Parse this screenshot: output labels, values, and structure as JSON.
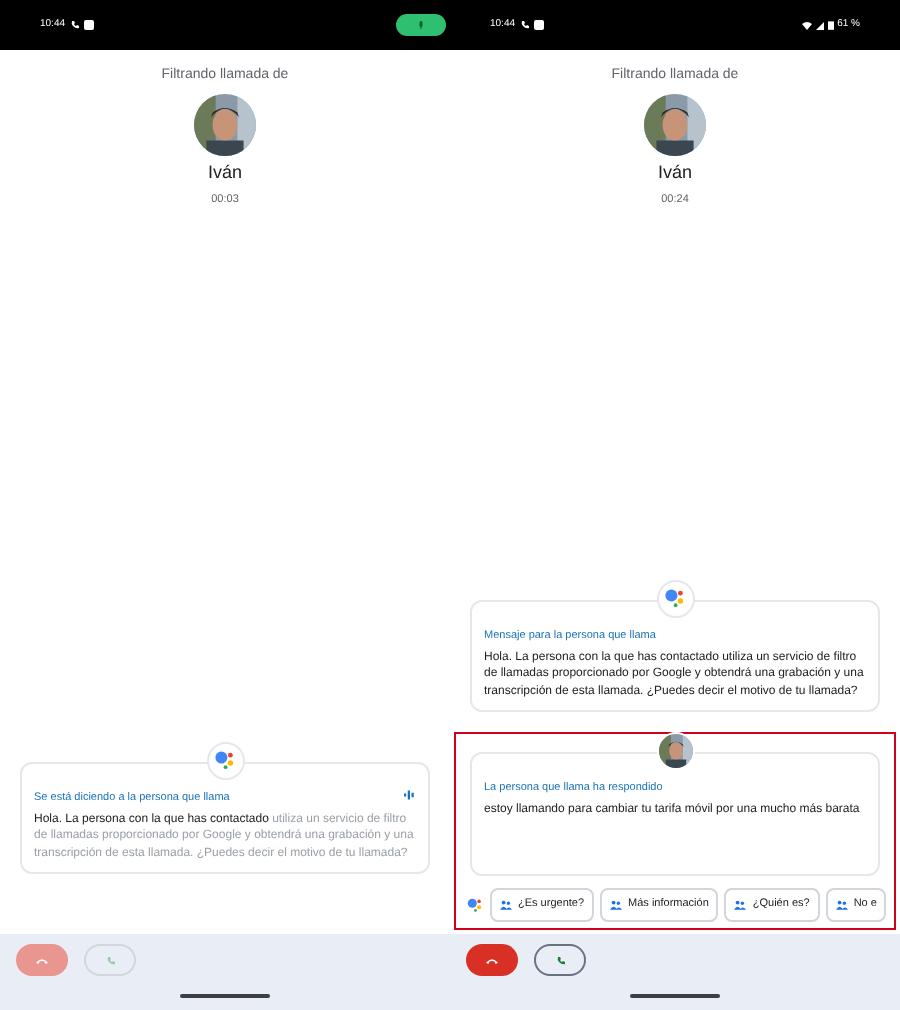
{
  "screens": [
    {
      "status_bar": {
        "time": "10:44",
        "mic_active": true
      },
      "header": {
        "title": "Filtrando llamada de",
        "caller_name": "Iván",
        "timer": "00:03"
      },
      "messages": [
        {
          "kind": "assistant",
          "label": "Se está diciendo a la persona que llama",
          "speaking": true,
          "spoken": "Hola. La persona con la que has contactado",
          "pending": "utiliza un servicio de filtro de llamadas proporcionado por Google y obtendrá una grabación y una transcripción de esta llamada. ¿Puedes decir el motivo de tu llamada?"
        }
      ],
      "controls_enabled": false
    },
    {
      "status_bar": {
        "time": "10:44",
        "battery": "61 %"
      },
      "header": {
        "title": "Filtrando llamada de",
        "caller_name": "Iván",
        "timer": "00:24"
      },
      "messages": [
        {
          "kind": "assistant",
          "label": "Mensaje para la persona que llama",
          "speaking": false,
          "spoken": "Hola. La persona con la que has contactado utiliza un servicio de filtro de llamadas proporcionado por Google y obtendrá una grabación y una transcripción de esta llamada. ¿Puedes decir el motivo de tu llamada?"
        },
        {
          "kind": "caller",
          "label": "La persona que llama ha respondido",
          "speaking": false,
          "spoken": "estoy llamando para cambiar tu tarifa móvil por una mucho más barata"
        }
      ],
      "suggestions": [
        "¿Es urgente?",
        "Más información",
        "¿Quién es?",
        "No e"
      ],
      "controls_enabled": true,
      "highlighted": true
    }
  ]
}
